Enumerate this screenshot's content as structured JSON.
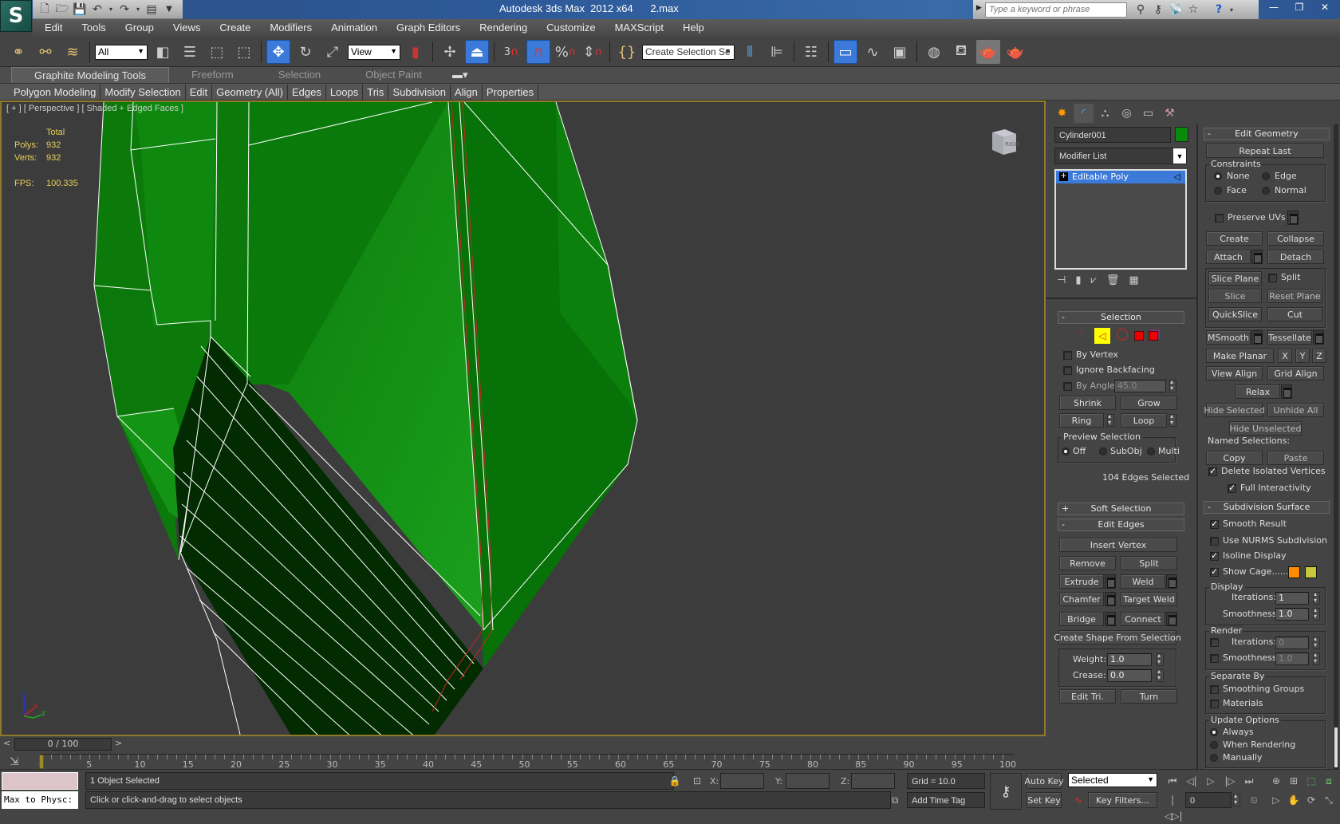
{
  "app": {
    "title": "Autodesk 3ds Max  2012 x64      2.max",
    "logo": "3ds-max-logo"
  },
  "quick_access": [
    "new-icon",
    "open-icon",
    "save-icon",
    "undo-icon",
    "redo-icon",
    "project-folder-icon",
    "customize-arrow-icon"
  ],
  "infocenter": {
    "search_placeholder": "Type a keyword or phrase",
    "icons": [
      "binoculars-icon",
      "key-icon",
      "satellite-icon",
      "star-icon",
      "help-icon"
    ]
  },
  "menu": [
    "Edit",
    "Tools",
    "Group",
    "Views",
    "Create",
    "Modifiers",
    "Animation",
    "Graph Editors",
    "Rendering",
    "Customize",
    "MAXScript",
    "Help"
  ],
  "toolbar": {
    "selection_filter": "All",
    "reference_coord": "View",
    "named_selection": "Create Selection Se",
    "snap_label": "3"
  },
  "ribbon": {
    "tabs": [
      "Graphite Modeling Tools",
      "Freeform",
      "Selection",
      "Object Paint"
    ],
    "active_tab": 0,
    "panels": [
      "Polygon Modeling",
      "Modify Selection",
      "Edit",
      "Geometry (All)",
      "Edges",
      "Loops",
      "Tris",
      "Subdivision",
      "Align",
      "Properties"
    ]
  },
  "viewport": {
    "label": "[ + ] [ Perspective ] [ Shaded + Edged Faces ]",
    "stats": {
      "header": "Total",
      "polys_label": "Polys:",
      "polys": "932",
      "verts_label": "Verts:",
      "verts": "932",
      "fps_label": "FPS:",
      "fps": "100.335"
    },
    "viewcube_face": "RIGHT",
    "axes": {
      "x": "x",
      "y": "y",
      "z": "z"
    },
    "colors": {
      "mesh_light": "#16991a",
      "mesh_dark": "#0a6a0c",
      "selected_faces": "#022b02",
      "wire": "#ffffff",
      "selected_edge": "#cc2222"
    }
  },
  "command_panel": {
    "tabs": [
      "create-icon",
      "modify-icon",
      "hierarchy-icon",
      "motion-icon",
      "display-icon",
      "utilities-icon"
    ],
    "object_name": "Cylinder001",
    "object_color": "#0a8a0a",
    "modifier_list": "Modifier List",
    "stack": [
      {
        "label": "Editable Poly",
        "selected": true
      }
    ],
    "stack_tools": [
      "pin-stack-icon",
      "show-end-result-icon",
      "make-unique-icon",
      "remove-modifier-icon",
      "configure-modifier-sets-icon"
    ]
  },
  "selection_rollout": {
    "title": "Selection",
    "subobjects": [
      "vertex",
      "edge",
      "border",
      "polygon",
      "element"
    ],
    "active_subobject": "edge",
    "by_vertex": "By Vertex",
    "by_vertex_checked": false,
    "ignore_backfacing": "Ignore Backfacing",
    "ignore_backfacing_checked": false,
    "by_angle": "By Angle:",
    "by_angle_checked": false,
    "angle_value": "45.0",
    "shrink": "Shrink",
    "grow": "Grow",
    "ring": "Ring",
    "loop": "Loop",
    "preview_title": "Preview Selection",
    "preview_options": [
      "Off",
      "SubObj",
      "Multi"
    ],
    "preview_selected": "Off",
    "status": "104 Edges Selected"
  },
  "soft_selection": {
    "title": "Soft Selection",
    "collapsed": true
  },
  "edit_edges": {
    "title": "Edit Edges",
    "insert_vertex": "Insert Vertex",
    "remove": "Remove",
    "split": "Split",
    "extrude": "Extrude",
    "weld": "Weld",
    "chamfer": "Chamfer",
    "target_weld": "Target Weld",
    "bridge": "Bridge",
    "connect": "Connect",
    "create_shape": "Create Shape From Selection",
    "weight_label": "Weight:",
    "weight": "1.0",
    "crease_label": "Crease:",
    "crease": "0.0",
    "edit_tri": "Edit Tri.",
    "turn": "Turn"
  },
  "edit_geometry": {
    "title": "Edit Geometry",
    "repeat_last": "Repeat Last",
    "constraints_title": "Constraints",
    "constraints": [
      "None",
      "Edge",
      "Face",
      "Normal"
    ],
    "constraint_selected": "None",
    "preserve_uvs": "Preserve UVs",
    "preserve_uvs_checked": false,
    "create": "Create",
    "collapse": "Collapse",
    "attach": "Attach",
    "detach": "Detach",
    "slice_plane": "Slice Plane",
    "split": "Split",
    "split_checked": false,
    "slice": "Slice",
    "reset_plane": "Reset Plane",
    "quickslice": "QuickSlice",
    "cut": "Cut",
    "msmooth": "MSmooth",
    "tessellate": "Tessellate",
    "make_planar": "Make Planar",
    "x": "X",
    "y": "Y",
    "z": "Z",
    "view_align": "View Align",
    "grid_align": "Grid Align",
    "relax": "Relax",
    "hide_selected": "Hide Selected",
    "unhide_all": "Unhide All",
    "hide_unselected": "Hide Unselected",
    "named_selections": "Named Selections:",
    "copy": "Copy",
    "paste": "Paste",
    "delete_isolated": "Delete Isolated Vertices",
    "delete_isolated_checked": true,
    "full_interactivity": "Full Interactivity",
    "full_interactivity_checked": true
  },
  "subdivision_surface": {
    "title": "Subdivision Surface",
    "smooth_result": "Smooth Result",
    "smooth_result_checked": true,
    "use_nurms": "Use NURMS Subdivision",
    "use_nurms_checked": false,
    "isoline": "Isoline Display",
    "isoline_checked": true,
    "show_cage": "Show Cage......",
    "show_cage_checked": true,
    "cage_color_1": "#ff8c00",
    "cage_color_2": "#c8c83c",
    "display_title": "Display",
    "iterations_label": "Iterations:",
    "display_iterations": "1",
    "smoothness_label": "Smoothness:",
    "display_smoothness": "1.0",
    "render_title": "Render",
    "render_iterations": "0",
    "render_smoothness": "1.0",
    "separate_title": "Separate By",
    "smoothing_groups": "Smoothing Groups",
    "materials": "Materials",
    "update_title": "Update Options",
    "update_options": [
      "Always",
      "When Rendering",
      "Manually"
    ],
    "update_selected": "Always"
  },
  "timeline": {
    "frame_display": "0 / 100",
    "current_frame": 0,
    "start": 0,
    "end": 100,
    "label_step": 5
  },
  "status": {
    "maxscript_listener": "Max to Physc:",
    "selection_status": "1 Object Selected",
    "prompt": "Click or click-and-drag to select objects",
    "x_label": "X:",
    "y_label": "Y:",
    "z_label": "Z:",
    "x": "",
    "y": "",
    "z": "",
    "grid": "Grid = 10.0",
    "add_time_tag": "Add Time Tag",
    "auto_key": "Auto Key",
    "set_key": "Set Key",
    "key_mode": "Selected",
    "key_filters": "Key Filters...",
    "frame_field": "0"
  }
}
